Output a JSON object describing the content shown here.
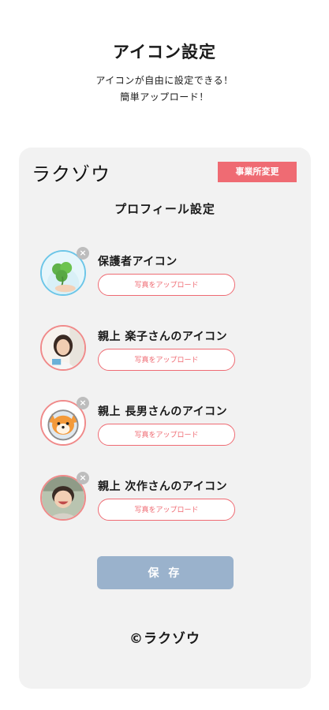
{
  "hero": {
    "title": "アイコン設定",
    "subtitle_line1": "アイコンが自由に設定できる！",
    "subtitle_line2": "簡単アップロード！"
  },
  "card": {
    "logo": "ラクゾウ",
    "office_change_label": "事業所変更",
    "title": "プロフィール設定",
    "rows": [
      {
        "label": "保護者アイコン",
        "upload_label": "写真をアップロード",
        "avatar": "clover-photo",
        "removable": true
      },
      {
        "label": "親上 楽子さんのアイコン",
        "upload_label": "写真をアップロード",
        "avatar": "woman-photo",
        "removable": false
      },
      {
        "label": "親上 長男さんのアイコン",
        "upload_label": "写真をアップロード",
        "avatar": "shiba-dog-illustration",
        "removable": true
      },
      {
        "label": "親上 次作さんのアイコン",
        "upload_label": "写真をアップロード",
        "avatar": "child-photo",
        "removable": true
      }
    ],
    "save_label": "保 存",
    "copyright": "©ラクゾウ"
  },
  "colors": {
    "accent_pink": "#ef6b73",
    "save_button": "#9ab2cc",
    "card_bg": "#f2f2f2"
  }
}
